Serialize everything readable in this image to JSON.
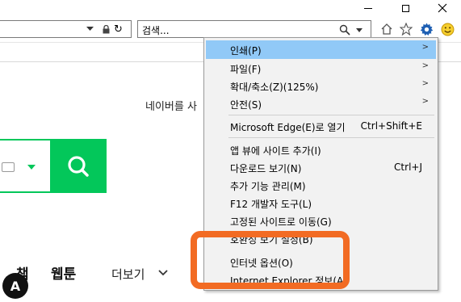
{
  "browser": {
    "search_placeholder": "검색...",
    "window_buttons": [
      "minimize-icon",
      "maximize-icon",
      "close-icon"
    ],
    "toolbar_icons": [
      "home-icon",
      "favorites-star-icon",
      "tools-gear-icon",
      "feedback-smiley-icon"
    ]
  },
  "page": {
    "login_text": "네이버를 사",
    "nav": {
      "item1": "책",
      "item2": "웹툰",
      "more": "더보기",
      "more_chevron": "❯"
    },
    "badge": "A",
    "brand_color": "#03c75a"
  },
  "menu": {
    "items": [
      {
        "label": "인쇄(P)",
        "shortcut": "",
        "submenu": true,
        "highlighted": true
      },
      {
        "label": "파일(F)",
        "shortcut": "",
        "submenu": true
      },
      {
        "label": "확대/축소(Z)(125%)",
        "shortcut": "",
        "submenu": true
      },
      {
        "label": "안전(S)",
        "shortcut": "",
        "submenu": true
      },
      {
        "label": "Microsoft Edge(E)로 열기",
        "shortcut": "Ctrl+Shift+E",
        "submenu": false
      },
      {
        "label": "앱 뷰에 사이트 추가(I)",
        "shortcut": "",
        "submenu": false
      },
      {
        "label": "다운로드 보기(N)",
        "shortcut": "Ctrl+J",
        "submenu": false
      },
      {
        "label": "추가 기능 관리(M)",
        "shortcut": "",
        "submenu": false
      },
      {
        "label": "F12 개발자 도구(L)",
        "shortcut": "",
        "submenu": false
      },
      {
        "label": "고정된 사이트로 이동(G)",
        "shortcut": "",
        "submenu": false
      },
      {
        "label": "호환성 보기 설정(B)",
        "shortcut": "",
        "submenu": false
      },
      {
        "label": "인터넷 옵션(O)",
        "shortcut": "",
        "submenu": false
      },
      {
        "label": "Internet Explorer 정보(A)",
        "shortcut": "",
        "submenu": false
      }
    ],
    "highlight_color": "#91c9f7",
    "annotation_color": "#f26b23"
  }
}
